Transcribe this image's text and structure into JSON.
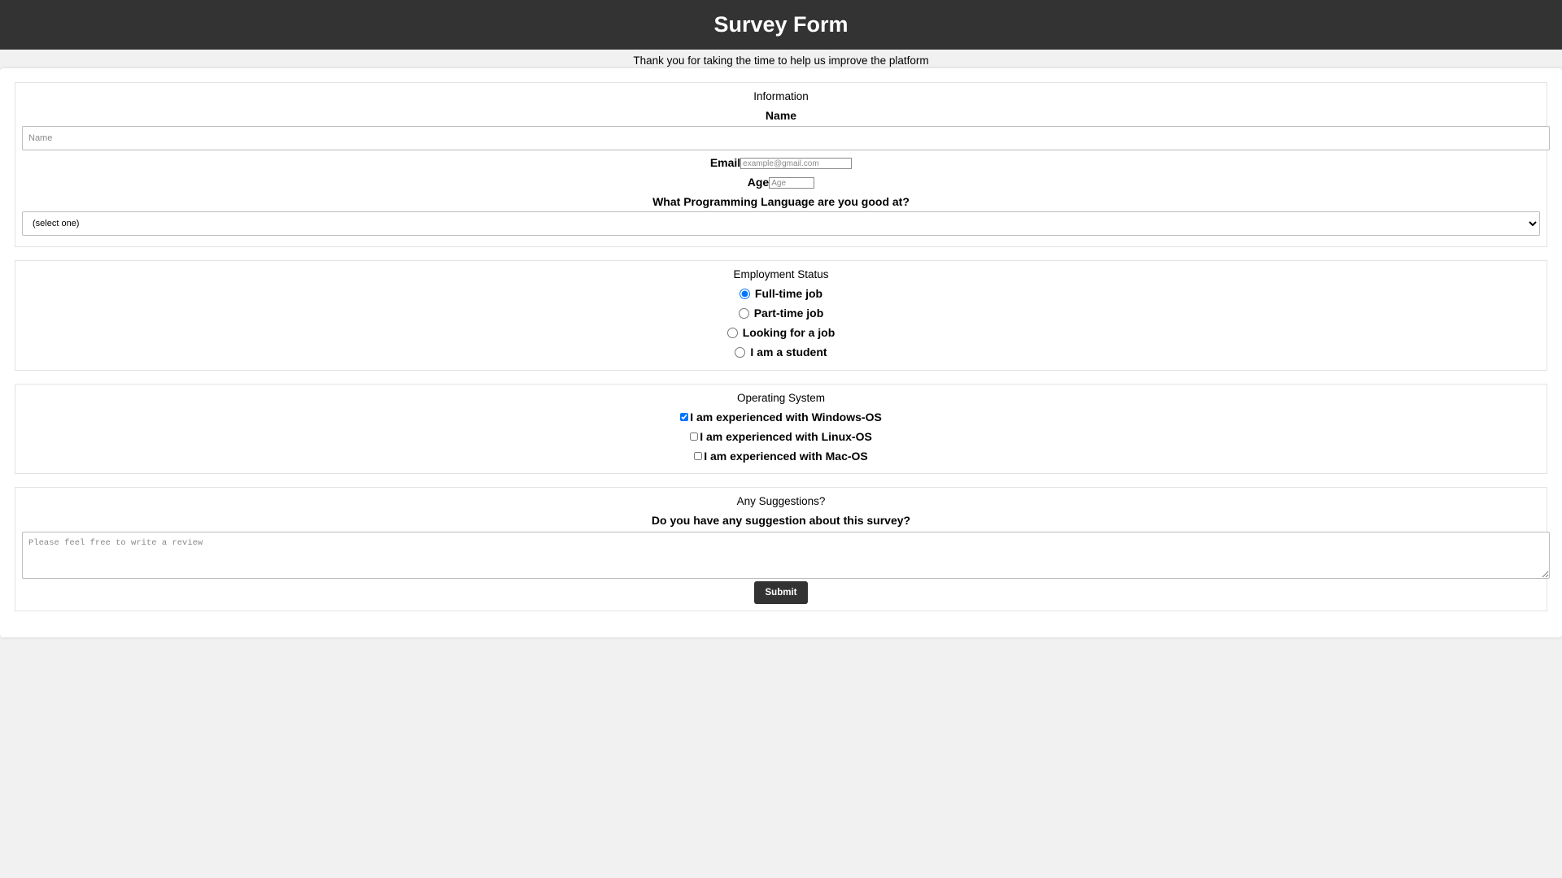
{
  "header": {
    "title": "Survey Form"
  },
  "subtitle": "Thank you for taking the time to help us improve the platform",
  "information": {
    "legend": "Information",
    "name_label": "Name",
    "name_placeholder": "Name",
    "email_label": "Email",
    "email_placeholder": "example@gmail.com",
    "age_label": "Age",
    "age_placeholder": "Age",
    "language_label": "What Programming Language are you good at?",
    "language_selected": "(select one)"
  },
  "employment": {
    "legend": "Employment Status",
    "options": [
      {
        "label": "Full-time job",
        "checked": true
      },
      {
        "label": "Part-time job",
        "checked": false
      },
      {
        "label": "Looking for a job",
        "checked": false
      },
      {
        "label": "I am a student",
        "checked": false
      }
    ]
  },
  "os": {
    "legend": "Operating System",
    "options": [
      {
        "label": "I am experienced with Windows-OS",
        "checked": true
      },
      {
        "label": "I am experienced with Linux-OS",
        "checked": false
      },
      {
        "label": "I am experienced with Mac-OS",
        "checked": false
      }
    ]
  },
  "suggestions": {
    "legend": "Any Suggestions?",
    "question": "Do you have any suggestion about this survey?",
    "placeholder": "Please feel free to write a review",
    "submit_label": "Submit"
  },
  "colors": {
    "header_bg": "#333333",
    "header_text": "#ffffff",
    "page_bg": "#f1f1f1",
    "accent_radio": "#1a73e8"
  }
}
